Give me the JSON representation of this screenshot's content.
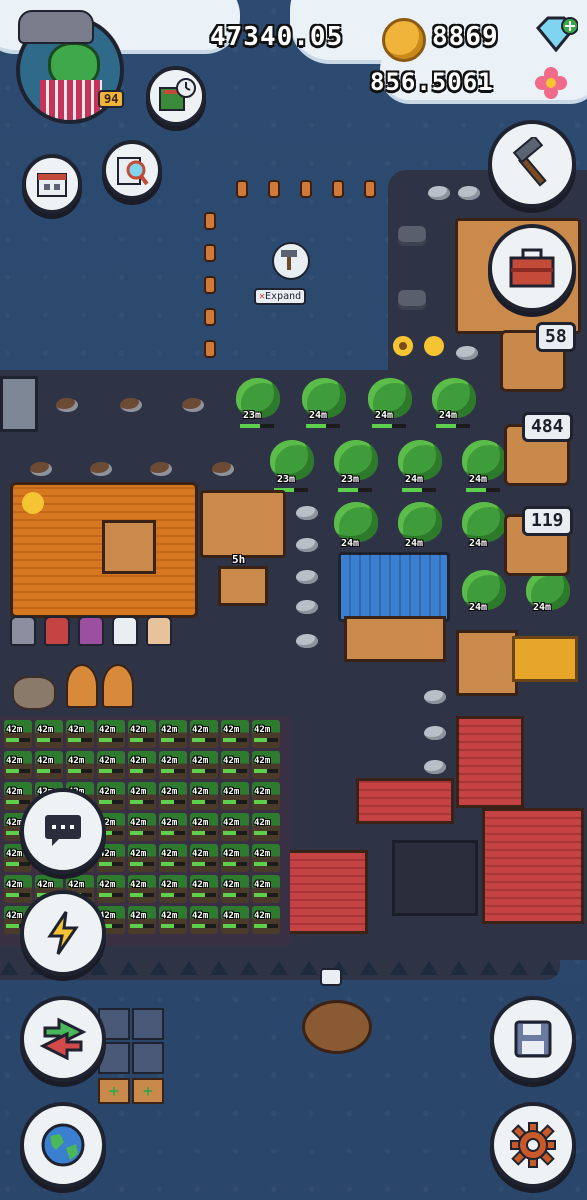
{
  "hud": {
    "coins": "47340.05",
    "gems": "8869",
    "flowers": "856.5061",
    "player_level": "94"
  },
  "map": {
    "expand_label": "Expand",
    "tree_timers": [
      "23m",
      "24m",
      "24m",
      "24m",
      "23m",
      "23m",
      "24m",
      "24m",
      "24m",
      "24m",
      "24m",
      "24m",
      "24m"
    ],
    "crop_timer": "42m",
    "building_timer": "5h"
  },
  "side_counts": {
    "first": "58",
    "second": "484",
    "third": "119"
  },
  "colors": {
    "water": "#2c4a6e",
    "island": "#2f3346",
    "coin": "#f0b43a",
    "gem": "#7fd4f0",
    "flower": "#f06a8a",
    "progress": "#5ed04e"
  },
  "icons": {
    "build": "hammer-icon",
    "shop": "toolbox-icon",
    "chat": "chat-icon",
    "boost": "lightning-icon",
    "trade": "swap-arrows-icon",
    "world": "globe-icon",
    "save": "floppy-disk-icon",
    "settings": "gear-icon",
    "calendar": "calendar-icon",
    "search": "magnifier-book-icon",
    "book_timer": "book-clock-icon"
  }
}
